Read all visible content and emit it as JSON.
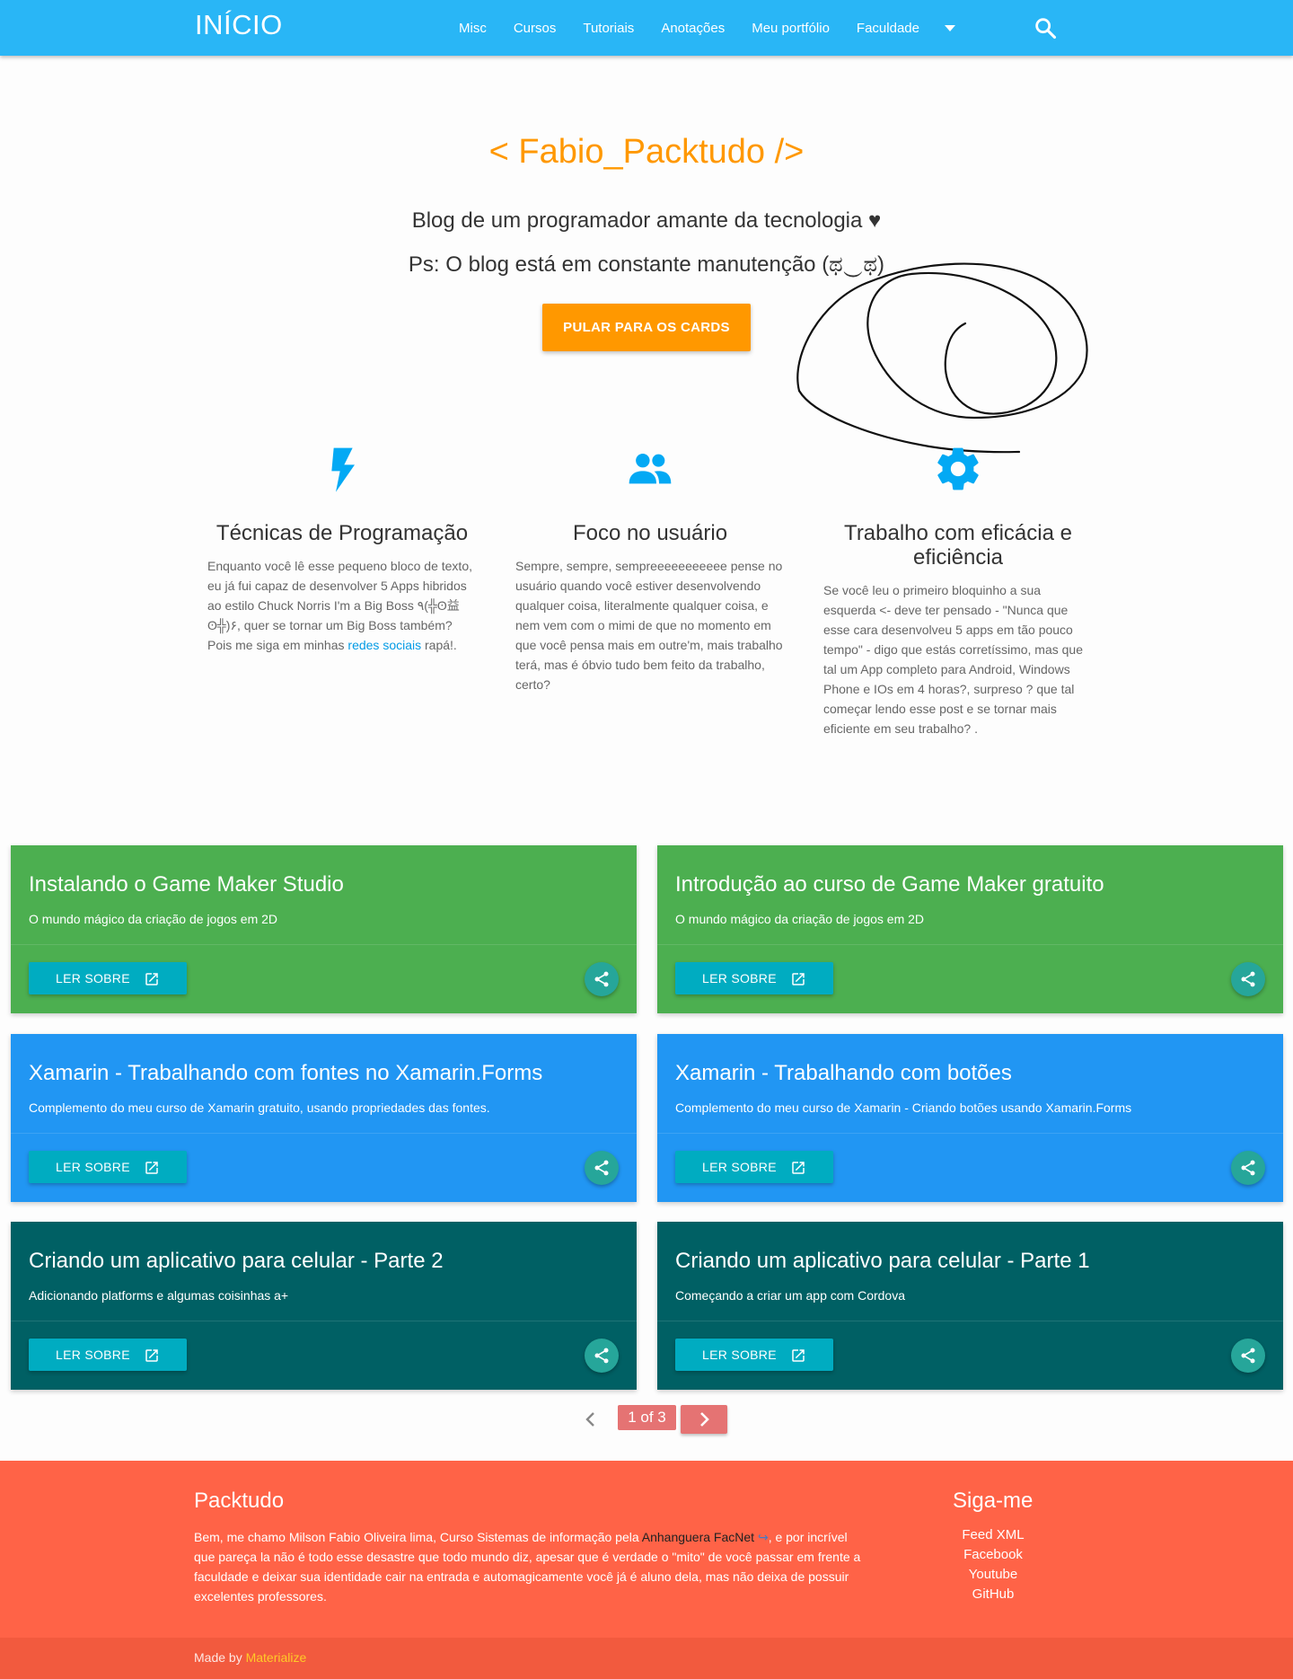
{
  "nav": {
    "brand": "INÍCIO",
    "items": [
      "Misc",
      "Cursos",
      "Tutoriais",
      "Anotações",
      "Meu portfólio",
      "Faculdade"
    ]
  },
  "hero": {
    "title": "< Fabio_Packtudo />",
    "subtitle": "Blog de um programador amante da tecnologia ♥",
    "note": "Ps: O blog está em constante manutenção (ಥ‿ಥ)",
    "button": "PULAR PARA OS CARDS"
  },
  "features": [
    {
      "icon": "flash-icon",
      "title": "Técnicas de Programação",
      "text_before_link": "Enquanto você lê esse pequeno bloco de texto, eu já fui capaz de desenvolver 5 Apps hibridos ao estilo Chuck Norris I'm a Big Boss ٩(╬ʘ益ʘ╬)۶, quer se tornar um Big Boss também? Pois me siga em minhas ",
      "link": "redes sociais",
      "text_after_link": " rapá!."
    },
    {
      "icon": "group-icon",
      "title": "Foco no usuário",
      "text": "Sempre, sempre, sempreeeeeeeeeee pense no usuário quando você estiver desenvolvendo qualquer coisa, literalmente qualquer coisa, e nem vem com o mimi de que no momento em que você pensa mais em outre'm, mais trabalho terá, mas é óbvio tudo bem feito da trabalho, certo?"
    },
    {
      "icon": "gear-icon",
      "title": "Trabalho com eficácia e eficiência",
      "text": "Se você leu o primeiro bloquinho a sua esquerda <- deve ter pensado - \"Nunca que esse cara desenvolveu 5 apps em tão pouco tempo\" - digo que estás corretíssimo, mas que tal um App completo para Android, Windows Phone e IOs em 4 horas?, surpreso ? que tal começar lendo esse post e se tornar mais eficiente em seu trabalho? ."
    }
  ],
  "cards": [
    {
      "title": "Instalando o Game Maker Studio",
      "subtitle": "O mundo mágico da criação de jogos em 2D",
      "color": "#4caf50"
    },
    {
      "title": "Introdução ao curso de Game Maker gratuito",
      "subtitle": "O mundo mágico da criação de jogos em 2D",
      "color": "#4caf50"
    },
    {
      "title": "Xamarin - Trabalhando com fontes no Xamarin.Forms",
      "subtitle": "Complemento do meu curso de Xamarin gratuito, usando propriedades das fontes.",
      "color": "#2196f3"
    },
    {
      "title": "Xamarin - Trabalhando com botões",
      "subtitle": "Complemento do meu curso de Xamarin - Criando botões usando Xamarin.Forms",
      "color": "#2196f3"
    },
    {
      "title": "Criando um aplicativo para celular - Parte 2",
      "subtitle": "Adicionando platforms e algumas coisinhas a+",
      "color": "#006064"
    },
    {
      "title": "Criando um aplicativo para celular - Parte 1",
      "subtitle": "Começando a criar um app com Cordova",
      "color": "#006064"
    }
  ],
  "card_button_label": "LER SOBRE",
  "pagination": {
    "current": "1 of 3"
  },
  "footer": {
    "title": "Packtudo",
    "about_before": "Bem, me chamo Milson Fabio Oliveira lima, Curso Sistemas de informação pela ",
    "about_link": "Anhanguera FacNet",
    "about_after": ", e por incrível que pareça la não é todo esse desastre que todo mundo diz, apesar que é verdade o \"mito\" de você passar em frente a faculdade e deixar sua identidade cair na entrada e automagicamente você já é aluno dela, mas não deixa de possuir excelentes professores.",
    "follow_title": "Siga-me",
    "links": [
      "Feed XML",
      "Facebook",
      "Youtube",
      "GitHub"
    ],
    "made_by": "Made by ",
    "made_by_link": "Materialize"
  }
}
